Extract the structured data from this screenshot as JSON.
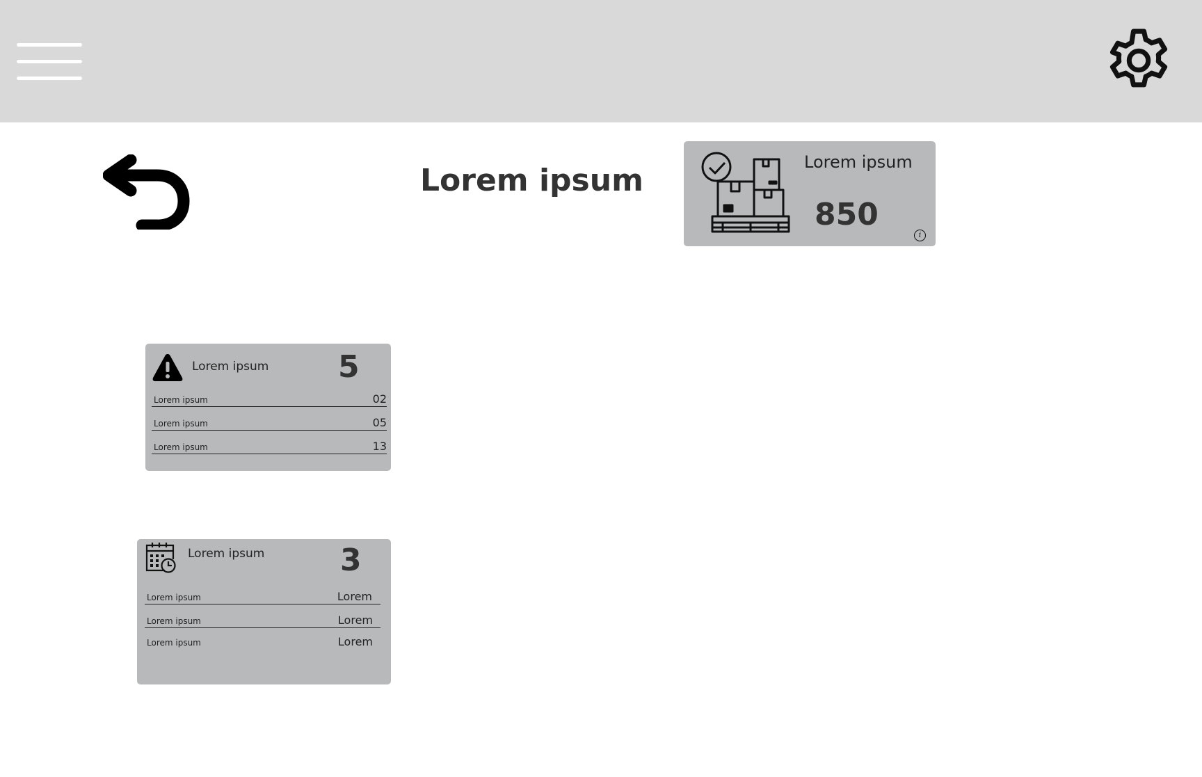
{
  "header": {
    "menu_icon": "hamburger-menu-icon",
    "settings_icon": "gear-icon",
    "background": "#d9d9d9"
  },
  "back_icon": "undo-arrow-icon",
  "page_title": "Lorem ipsum",
  "kpi_card": {
    "icon": "pallet-boxes-check-icon",
    "label": "Lorem ipsum",
    "value": "850",
    "info_icon": "info-icon",
    "info_glyph": "i"
  },
  "alert_card": {
    "icon": "warning-icon",
    "label": "Lorem ipsum",
    "count": "5",
    "rows": [
      {
        "label": "Lorem ipsum",
        "value": "02"
      },
      {
        "label": "Lorem ipsum",
        "value": "05"
      },
      {
        "label": "Lorem ipsum",
        "value": "13"
      }
    ]
  },
  "schedule_card": {
    "icon": "calendar-clock-icon",
    "label": "Lorem ipsum",
    "count": "3",
    "rows": [
      {
        "label": "Lorem ipsum",
        "value": "Lorem"
      },
      {
        "label": "Lorem ipsum",
        "value": "Lorem"
      },
      {
        "label": "Lorem ipsum",
        "value": "Lorem"
      }
    ]
  },
  "colors": {
    "card_background": "#b8b9ba",
    "text_dark": "#333333"
  }
}
